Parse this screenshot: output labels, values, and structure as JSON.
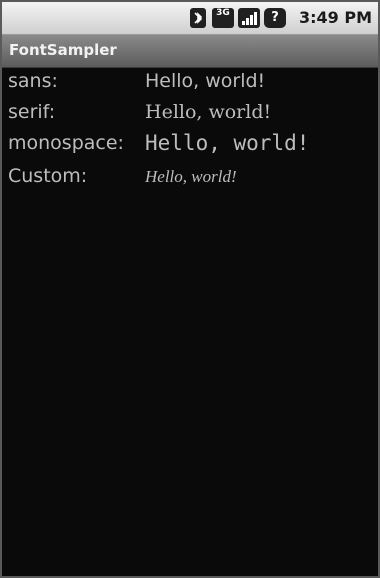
{
  "status_bar": {
    "time": "3:49 PM",
    "icons": {
      "bluetooth": "bluetooth-icon",
      "network": "3g-icon",
      "network_label": "3G",
      "signal": "signal-icon",
      "alert": "alert-icon",
      "alert_glyph": "?"
    }
  },
  "app": {
    "title": "FontSampler"
  },
  "rows": [
    {
      "label": "sans:",
      "value": "Hello, world!"
    },
    {
      "label": "serif:",
      "value": "Hello, world!"
    },
    {
      "label": "monospace:",
      "value": "Hello, world!"
    },
    {
      "label": "Custom:",
      "value": "Hello, world!"
    }
  ],
  "colors": {
    "background": "#0a0a0a",
    "text": "#bdbdbd",
    "title_bar": "#6e6e6e",
    "status_bar": "#dcdcdc"
  }
}
